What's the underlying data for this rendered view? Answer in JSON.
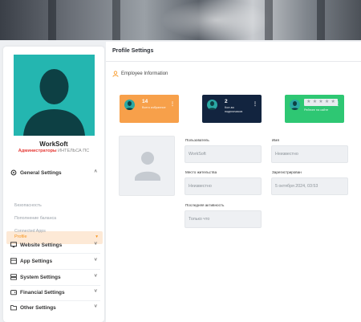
{
  "colors": {
    "accent": "#f7941d",
    "teal": "#1fb3ad",
    "orange_card": "#f7a04a",
    "navy_card": "#12243f",
    "green_card": "#2ec773",
    "role_red": "#e53935"
  },
  "sidebar": {
    "name": "WorkSoft",
    "role_main": "Администраторы",
    "role_sub": "ИНТЕЛЬСА ПС",
    "general": {
      "label": "General Settings",
      "icon": "gear-icon",
      "chevron": "˄"
    },
    "active_item": {
      "label": "Profile",
      "chevron": "▾"
    },
    "subitems": [
      "Безопасность",
      "Пополнение баланса",
      "Connected Apps"
    ],
    "sections": [
      {
        "label": "Website Settings",
        "icon": "monitor-icon"
      },
      {
        "label": "App Settings",
        "icon": "grid-icon"
      },
      {
        "label": "System Settings",
        "icon": "server-icon"
      },
      {
        "label": "Financial Settings",
        "icon": "wallet-icon"
      },
      {
        "label": "Other Settings",
        "icon": "folder-icon"
      }
    ],
    "section_chevron": "˅"
  },
  "main": {
    "title": "Profile Settings",
    "employee_info": "Employee Information",
    "cards": [
      {
        "value": "14",
        "caption": "Всего избранное",
        "dots": "⋮"
      },
      {
        "value": "2",
        "caption": "Кол-во\nподписчиков",
        "dots": "⋮"
      },
      {
        "value": "",
        "caption": "Рейтинг на сайте",
        "dots": "⋮",
        "stars": [
          "★",
          "★",
          "★",
          "★",
          "★"
        ]
      }
    ],
    "fields": {
      "user": {
        "label": "Пользователь",
        "value": "WorkSoft"
      },
      "name": {
        "label": "Имя",
        "value": "Неизвестно"
      },
      "city": {
        "label": "Место жительства",
        "value": "Неизвестно"
      },
      "registered": {
        "label": "Зарегистрирован",
        "value": "5 октября 2024, 03:53"
      },
      "last_activity": {
        "label": "Последняя активность",
        "value": "Только что"
      }
    }
  }
}
